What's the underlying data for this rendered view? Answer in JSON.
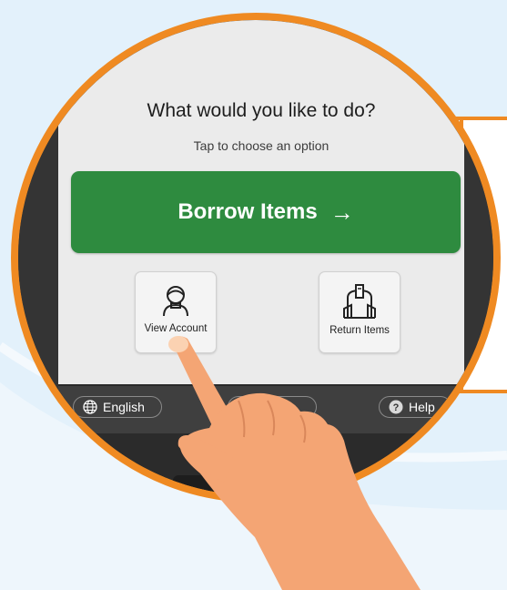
{
  "screen": {
    "title": "What would you like to do?",
    "subtitle": "Tap to choose an option"
  },
  "actions": {
    "borrow_label": "Borrow Items",
    "view_account_label": "View Account",
    "return_label": "Return Items"
  },
  "footer": {
    "language_label": "English",
    "help_label": "Help"
  },
  "colors": {
    "accent_orange": "#ef8a22",
    "borrow_green": "#2e8b3f",
    "screen_bg": "#ebebeb",
    "kiosk_dark": "#343434"
  },
  "icons": {
    "borrow": "arrow-right-icon",
    "view_account": "person-icon",
    "return": "return-slot-icon",
    "language": "globe-icon",
    "help": "question-icon"
  }
}
